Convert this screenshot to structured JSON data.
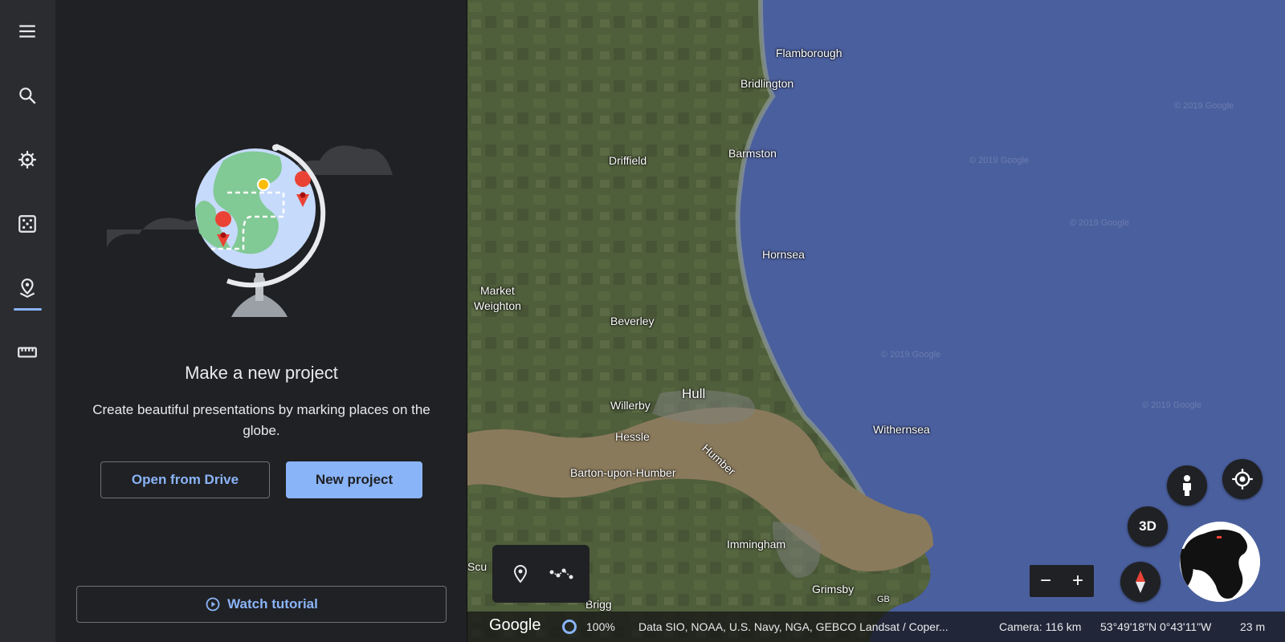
{
  "rail": {
    "items": [
      {
        "icon": "menu-icon"
      },
      {
        "icon": "search-icon"
      },
      {
        "icon": "voyager-icon"
      },
      {
        "icon": "feeling-lucky-icon"
      },
      {
        "icon": "projects-icon"
      },
      {
        "icon": "measure-icon"
      }
    ]
  },
  "panel": {
    "title": "Make a new project",
    "description": "Create beautiful presentations by marking places on the globe.",
    "open_drive_label": "Open from Drive",
    "new_project_label": "New project",
    "tutorial_label": "Watch tutorial"
  },
  "map": {
    "places": [
      {
        "name": "Flamborough"
      },
      {
        "name": "Bridlington"
      },
      {
        "name": "Driffield"
      },
      {
        "name": "Barmston"
      },
      {
        "name": "Hornsea"
      },
      {
        "name": "Market"
      },
      {
        "name": "Weighton"
      },
      {
        "name": "Beverley"
      },
      {
        "name": "Hull"
      },
      {
        "name": "Willerby"
      },
      {
        "name": "Hessle"
      },
      {
        "name": "Withernsea"
      },
      {
        "name": "Humber"
      },
      {
        "name": "Barton-upon-Humber"
      },
      {
        "name": "Immingham"
      },
      {
        "name": "Grimsby"
      },
      {
        "name": "Brigg"
      },
      {
        "name": "Scu"
      },
      {
        "name": "GB"
      }
    ],
    "copyright_text": "© 2019 Google",
    "three_d_label": "3D",
    "zoom_out": "−",
    "zoom_in": "+"
  },
  "status": {
    "google": "Google",
    "load_percent": "100%",
    "attribution": "Data SIO, NOAA, U.S. Navy, NGA, GEBCO  Landsat / Coper...",
    "camera": "Camera: 116 km",
    "coords": "53°49'18\"N 0°43'11\"W",
    "elevation": "23 m"
  },
  "colors": {
    "accent": "#8ab4f8",
    "panel_bg": "#202124",
    "rail_bg": "#2b2c2f",
    "sea": "#4a5f9e",
    "land": "#4f5e3b",
    "estuary": "#8a7a5c"
  }
}
